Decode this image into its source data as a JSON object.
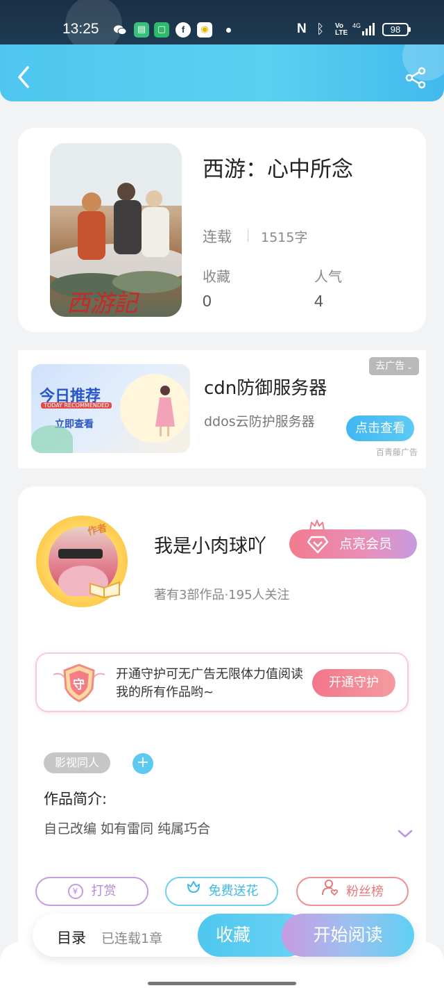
{
  "status_bar": {
    "time": "13:25",
    "battery": "98",
    "icons": [
      "wechat-icon",
      "app-icon",
      "app-icon",
      "facebook-icon",
      "app-icon",
      "dot-icon",
      "nfc-icon",
      "bluetooth-icon",
      "volte-icon",
      "4g-signal-icon"
    ]
  },
  "header": {
    "back_icon": "chevron-left-icon",
    "share_icon": "share-icon",
    "color": "#4fc6f0"
  },
  "book": {
    "title": "西游：心中所念",
    "status": "连载",
    "word_count": "1515字",
    "favorites_label": "收藏",
    "favorites_value": "0",
    "popularity_label": "人气",
    "popularity_value": "4"
  },
  "ad": {
    "image_title": "今日推荐",
    "image_subtitle": "TODAY RECOMMENDED",
    "image_cta": "立即查看",
    "title": "cdn防御服务器",
    "subtitle": "ddos云防护服务器",
    "remove_label": "去广告",
    "cta_label": "点击查看",
    "source": "百青藤广告"
  },
  "author": {
    "badge": "作者",
    "name": "我是小肉球吖",
    "stats": "著有3部作品·195人关注",
    "vip_label": "点亮会员"
  },
  "guard": {
    "icon_text": "守",
    "text": "开通守护可无广告无限体力值阅读我的所有作品哟~",
    "button_label": "开通守护"
  },
  "tags": [
    "影视同人"
  ],
  "intro": {
    "label": "作品简介:",
    "text": "自己改编 如有雷同 纯属巧合"
  },
  "actions": {
    "tip_label": "打赏",
    "flower_label": "免费送花",
    "fans_label": "粉丝榜"
  },
  "bottom": {
    "toc_label": "目录",
    "toc_count": "已连载1章",
    "favorite_label": "收藏",
    "read_label": "开始阅读"
  }
}
